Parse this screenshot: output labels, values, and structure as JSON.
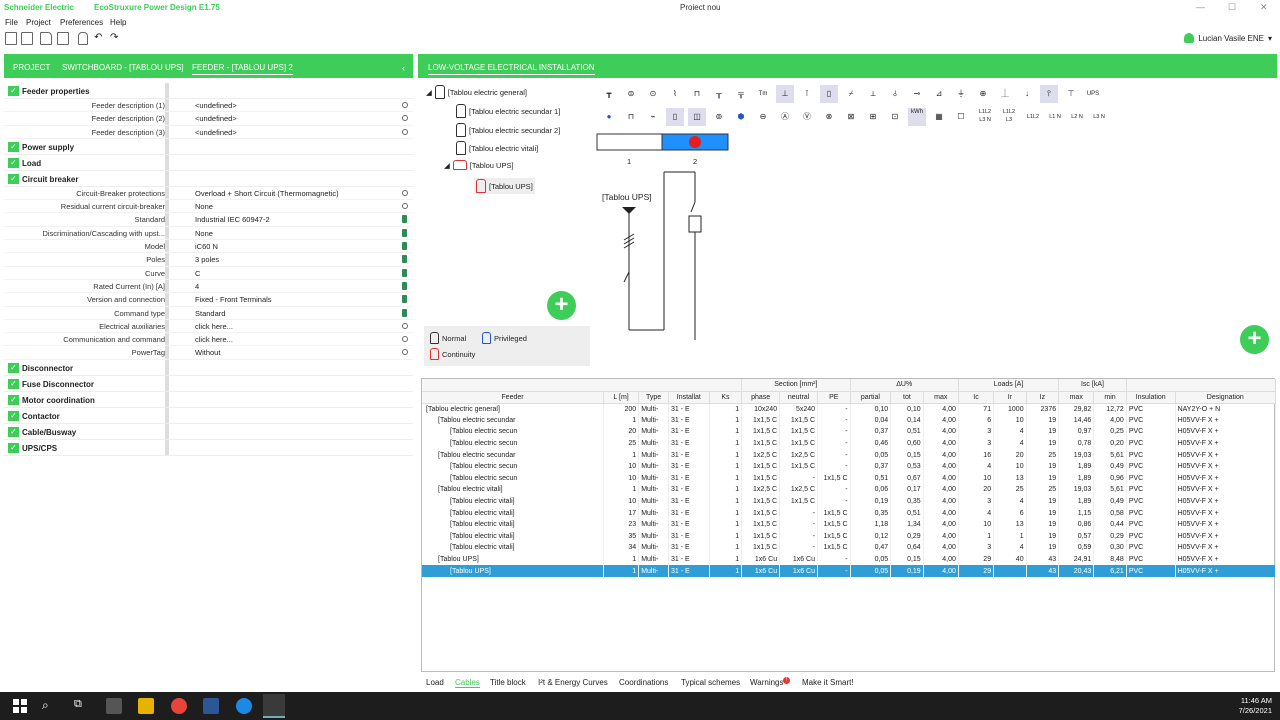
{
  "titlebar": {
    "brand": "Schneider Electric",
    "app": "EcoStruxure Power Design E1.75",
    "project": "Proiect nou"
  },
  "menu": [
    "File",
    "Project",
    "Preferences",
    "Help"
  ],
  "user": {
    "name": "Lucian Vasile ENE"
  },
  "left_tabs": {
    "project": "PROJECT",
    "switchboard": "SWITCHBOARD - [TABLOU UPS]",
    "feeder": "FEEDER - [TABLOU UPS] 2"
  },
  "sections": {
    "feeder": "Feeder properties",
    "power": "Power supply",
    "load": "Load",
    "cb": "Circuit breaker",
    "disconnector": "Disconnector",
    "fuse": "Fuse Disconnector",
    "motor": "Motor coordination",
    "contactor": "Contactor",
    "cable": "Cable/Busway",
    "ups": "UPS/CPS"
  },
  "feeder_rows": [
    {
      "label": "Feeder description (1)",
      "value": "<undefined>"
    },
    {
      "label": "Feeder description (2)",
      "value": "<undefined>"
    },
    {
      "label": "Feeder description (3)",
      "value": "<undefined>"
    }
  ],
  "cb_rows": [
    {
      "label": "Circuit-Breaker protections",
      "value": "Overload + Short Circuit (Thermomagnetic)"
    },
    {
      "label": "Residual current circuit-breaker",
      "value": "None"
    },
    {
      "label": "Standard",
      "value": "Industrial IEC 60947-2"
    },
    {
      "label": "Discrimination/Cascading with upst...",
      "value": "None"
    },
    {
      "label": "Model",
      "value": "iC60 N"
    },
    {
      "label": "Poles",
      "value": "3 poles"
    },
    {
      "label": "Curve",
      "value": "C"
    },
    {
      "label": "Rated Current (In) [A]",
      "value": "4"
    },
    {
      "label": "Version and connection",
      "value": "Fixed - Front Terminals"
    },
    {
      "label": "Command type",
      "value": "Standard"
    },
    {
      "label": "Electrical auxiliaries",
      "value": "click here..."
    },
    {
      "label": "Communication and command",
      "value": "click here..."
    },
    {
      "label": "PowerTag",
      "value": "Without"
    }
  ],
  "right_tab": "LOW-VOLTAGE ELECTRICAL INSTALLATION",
  "tree": {
    "root": "[Tablou electric general]",
    "c1": "[Tablou electric secundar 1]",
    "c2": "[Tablou electric secundar 2]",
    "c3": "[Tablou electric vitali]",
    "c4": "[Tablou UPS]",
    "c5": "[Tablou UPS]"
  },
  "legend": {
    "normal": "Normal",
    "privileged": "Privileged",
    "continuity": "Continuity"
  },
  "symbols_row2": [
    "kWh",
    "L1L2 L3 N",
    "L1L2 L3",
    "L1L2",
    "L1 N",
    "L2 N",
    "L3 N",
    "UPS",
    "Tm"
  ],
  "diagram": {
    "col1": "1",
    "col2": "2",
    "label": "[Tablou UPS]"
  },
  "table_headers": {
    "group": {
      "section": "Section [mm²]",
      "du": "ΔU%",
      "loads": "Loads [A]",
      "isc": "Isc [kA]"
    },
    "cols": [
      "Feeder",
      "L [m]",
      "Type",
      "Installat",
      "Ks",
      "phase",
      "neutral",
      "PE",
      "partial",
      "tot",
      "max",
      "Ic",
      "Ir",
      "Iz",
      "max",
      "min",
      "Insulation",
      "Designation"
    ]
  },
  "table_rows": [
    [
      "[Tablou electric general]",
      "200",
      "Multi-",
      "31 - E",
      "1",
      "10x240",
      "5x240",
      "-",
      "0,10",
      "0,10",
      "4,00",
      "71",
      "1000",
      "2376",
      "29,82",
      "12,72",
      "PVC",
      "NAY2Y-O + N"
    ],
    [
      "[Tablou electric secundar",
      "1",
      "Multi-",
      "31 - E",
      "1",
      "1x1,5 C",
      "1x1,5 C",
      "-",
      "0,04",
      "0,14",
      "4,00",
      "6",
      "10",
      "19",
      "14,46",
      "4,00",
      "PVC",
      "H05VV-F X +"
    ],
    [
      "[Tablou electric secun",
      "20",
      "Multi-",
      "31 - E",
      "1",
      "1x1,5 C",
      "1x1,5 C",
      "-",
      "0,37",
      "0,51",
      "4,00",
      "3",
      "4",
      "19",
      "0,97",
      "0,25",
      "PVC",
      "H05VV-F X +"
    ],
    [
      "[Tablou electric secun",
      "25",
      "Multi-",
      "31 - E",
      "1",
      "1x1,5 C",
      "1x1,5 C",
      "-",
      "0,46",
      "0,60",
      "4,00",
      "3",
      "4",
      "19",
      "0,78",
      "0,20",
      "PVC",
      "H05VV-F X +"
    ],
    [
      "[Tablou electric secundar",
      "1",
      "Multi-",
      "31 - E",
      "1",
      "1x2,5 C",
      "1x2,5 C",
      "-",
      "0,05",
      "0,15",
      "4,00",
      "16",
      "20",
      "25",
      "19,03",
      "5,61",
      "PVC",
      "H05VV-F X +"
    ],
    [
      "[Tablou electric secun",
      "10",
      "Multi-",
      "31 - E",
      "1",
      "1x1,5 C",
      "1x1,5 C",
      "-",
      "0,37",
      "0,53",
      "4,00",
      "4",
      "10",
      "19",
      "1,89",
      "0,49",
      "PVC",
      "H05VV-F X +"
    ],
    [
      "[Tablou electric secun",
      "10",
      "Multi-",
      "31 - E",
      "1",
      "1x1,5 C",
      "-",
      "1x1,5 C",
      "0,51",
      "0,67",
      "4,00",
      "10",
      "13",
      "19",
      "1,89",
      "0,96",
      "PVC",
      "H05VV-F X +"
    ],
    [
      "[Tablou electric vitali]",
      "1",
      "Multi-",
      "31 - E",
      "1",
      "1x2,5 C",
      "1x2,5 C",
      "-",
      "0,06",
      "0,17",
      "4,00",
      "20",
      "25",
      "25",
      "19,03",
      "5,61",
      "PVC",
      "H05VV-F X +"
    ],
    [
      "[Tablou electric vitali]",
      "10",
      "Multi-",
      "31 - E",
      "1",
      "1x1,5 C",
      "1x1,5 C",
      "-",
      "0,19",
      "0,35",
      "4,00",
      "3",
      "4",
      "19",
      "1,89",
      "0,49",
      "PVC",
      "H05VV-F X +"
    ],
    [
      "[Tablou electric vitali]",
      "17",
      "Multi-",
      "31 - E",
      "1",
      "1x1,5 C",
      "-",
      "1x1,5 C",
      "0,35",
      "0,51",
      "4,00",
      "4",
      "6",
      "19",
      "1,15",
      "0,58",
      "PVC",
      "H05VV-F X +"
    ],
    [
      "[Tablou electric vitali]",
      "23",
      "Multi-",
      "31 - E",
      "1",
      "1x1,5 C",
      "-",
      "1x1,5 C",
      "1,18",
      "1,34",
      "4,00",
      "10",
      "13",
      "19",
      "0,86",
      "0,44",
      "PVC",
      "H05VV-F X +"
    ],
    [
      "[Tablou electric vitali]",
      "35",
      "Multi-",
      "31 - E",
      "1",
      "1x1,5 C",
      "-",
      "1x1,5 C",
      "0,12",
      "0,29",
      "4,00",
      "1",
      "1",
      "19",
      "0,57",
      "0,29",
      "PVC",
      "H05VV-F X +"
    ],
    [
      "[Tablou electric vitali]",
      "34",
      "Multi-",
      "31 - E",
      "1",
      "1x1,5 C",
      "-",
      "1x1,5 C",
      "0,47",
      "0,64",
      "4,00",
      "3",
      "4",
      "19",
      "0,59",
      "0,30",
      "PVC",
      "H05VV-F X +"
    ],
    [
      "[Tablou UPS]",
      "1",
      "Multi-",
      "31 - E",
      "1",
      "1x6 Cu",
      "1x6 Cu",
      "-",
      "0,05",
      "0,15",
      "4,00",
      "29",
      "40",
      "43",
      "24,91",
      "8,48",
      "PVC",
      "H05VV-F X +"
    ],
    [
      "[Tablou UPS]",
      "1",
      "Multi-",
      "31 - E",
      "1",
      "1x6 Cu",
      "1x6 Cu",
      "-",
      "0,05",
      "0,19",
      "4,00",
      "29",
      "",
      "43",
      "20,43",
      "6,21",
      "PVC",
      "H05VV-F X +"
    ]
  ],
  "bottom_tabs": {
    "load": "Load",
    "cables": "Cables",
    "title": "Title block",
    "it": "I²t & Energy Curves",
    "coord": "Coordinations",
    "typical": "Typical schemes",
    "warnings": "Warnings",
    "smart": "Make it Smart!"
  },
  "clock": {
    "time": "11:46 AM",
    "date": "7/26/2021"
  },
  "colors": {
    "accent": "#3dcd58",
    "selection": "#2f9ed7"
  }
}
